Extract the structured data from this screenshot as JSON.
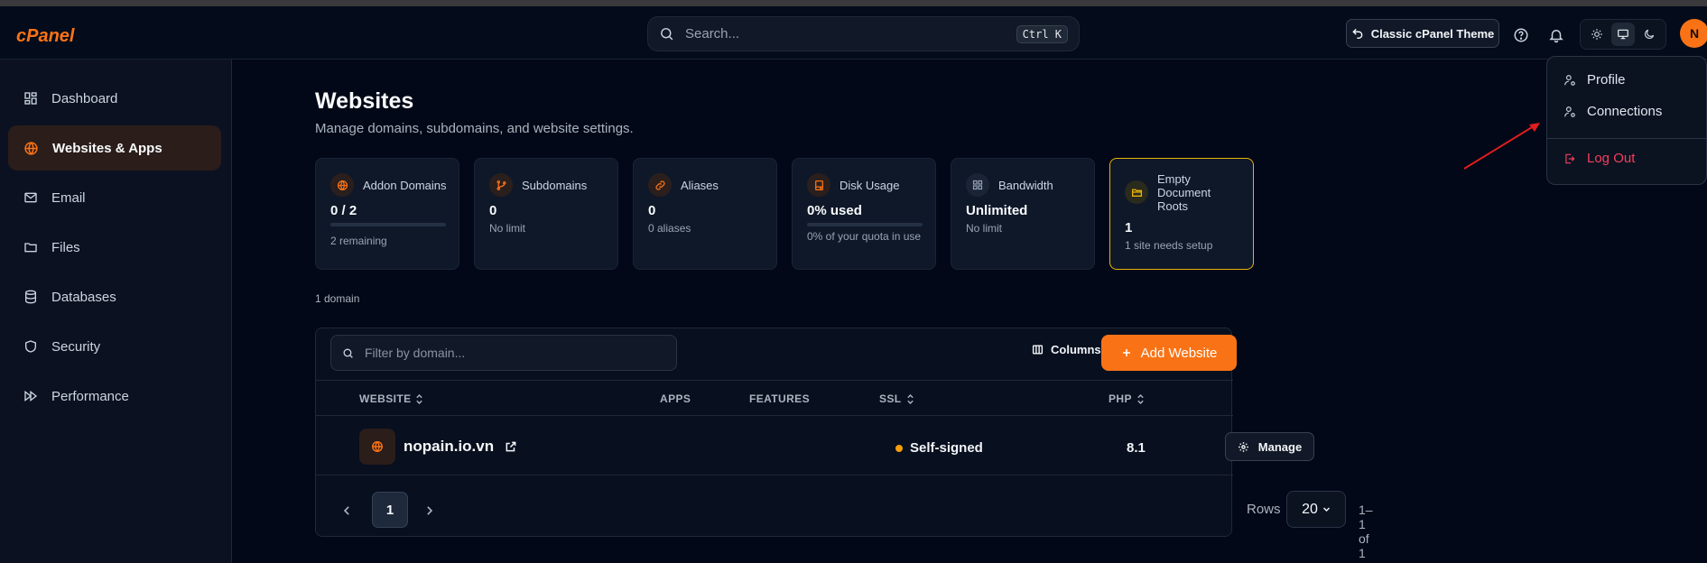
{
  "header": {
    "brand": "cPanel",
    "search_placeholder": "Search...",
    "shortcut": "Ctrl K",
    "classic_theme_label": "Classic cPanel Theme",
    "avatar_initial": "N"
  },
  "sidebar": {
    "items": [
      {
        "label": "Dashboard",
        "icon": "dashboard-icon"
      },
      {
        "label": "Websites & Apps",
        "icon": "globe-icon",
        "active": true
      },
      {
        "label": "Email",
        "icon": "mail-icon"
      },
      {
        "label": "Files",
        "icon": "folder-icon"
      },
      {
        "label": "Databases",
        "icon": "database-icon"
      },
      {
        "label": "Security",
        "icon": "shield-icon"
      },
      {
        "label": "Performance",
        "icon": "fast-forward-icon"
      }
    ]
  },
  "page": {
    "title": "Websites",
    "subtitle": "Manage domains, subdomains, and website settings.",
    "domain_count": "1 domain"
  },
  "cards": [
    {
      "label": "Addon Domains",
      "value": "0 / 2",
      "sub": "2 remaining",
      "progress": 0
    },
    {
      "label": "Subdomains",
      "value": "0",
      "sub": "No limit"
    },
    {
      "label": "Aliases",
      "value": "0",
      "sub": "0 aliases"
    },
    {
      "label": "Disk Usage",
      "value": "0% used",
      "sub": "0% of your quota in use",
      "progress": 0
    },
    {
      "label": "Bandwidth",
      "value": "Unlimited",
      "sub": "No limit"
    },
    {
      "label": "Empty Document Roots",
      "value": "1",
      "sub": "1 site needs setup",
      "warning": true
    }
  ],
  "table": {
    "filter_placeholder": "Filter by domain...",
    "columns_label": "Columns",
    "add_label": "Add Website",
    "headers": {
      "website": "WEBSITE",
      "apps": "APPS",
      "features": "FEATURES",
      "ssl": "SSL",
      "php": "PHP"
    },
    "rows": [
      {
        "domain": "nopain.io.vn",
        "ssl": "Self-signed",
        "php": "8.1",
        "action": "Manage"
      }
    ],
    "page": "1",
    "rows_label": "Rows",
    "rows_per_page": "20",
    "range": "1–1 of 1"
  },
  "menu": {
    "profile": "Profile",
    "connections": "Connections",
    "logout": "Log Out"
  },
  "colors": {
    "accent": "#f97316",
    "warning": "#eab308",
    "danger": "#f43f5e",
    "background": "#020817"
  }
}
